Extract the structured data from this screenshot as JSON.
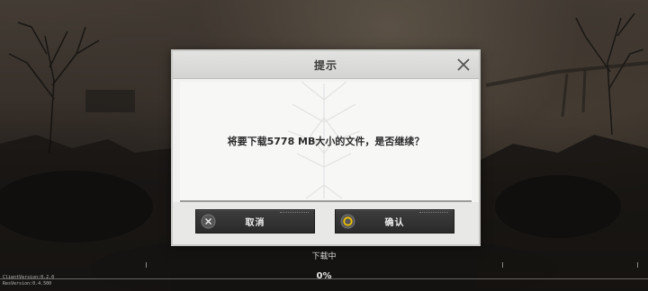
{
  "dialog": {
    "title": "提示",
    "message": "将要下载5778 MB大小的文件，是否继续？",
    "cancel_label": "取消",
    "confirm_label": "确认"
  },
  "status": {
    "label": "下载中",
    "progress_text": "0%",
    "progress": 0
  },
  "version": {
    "client": "ClientVersion:0.2.0",
    "res": "ResVersion:0.4.500"
  },
  "icons": {
    "close": "close-icon",
    "cancel": "x-icon",
    "confirm": "circle-icon"
  },
  "colors": {
    "confirm_accent": "#f2c200",
    "button_bg": "#2e2e2e",
    "dialog_bg": "#f2f2f0"
  }
}
